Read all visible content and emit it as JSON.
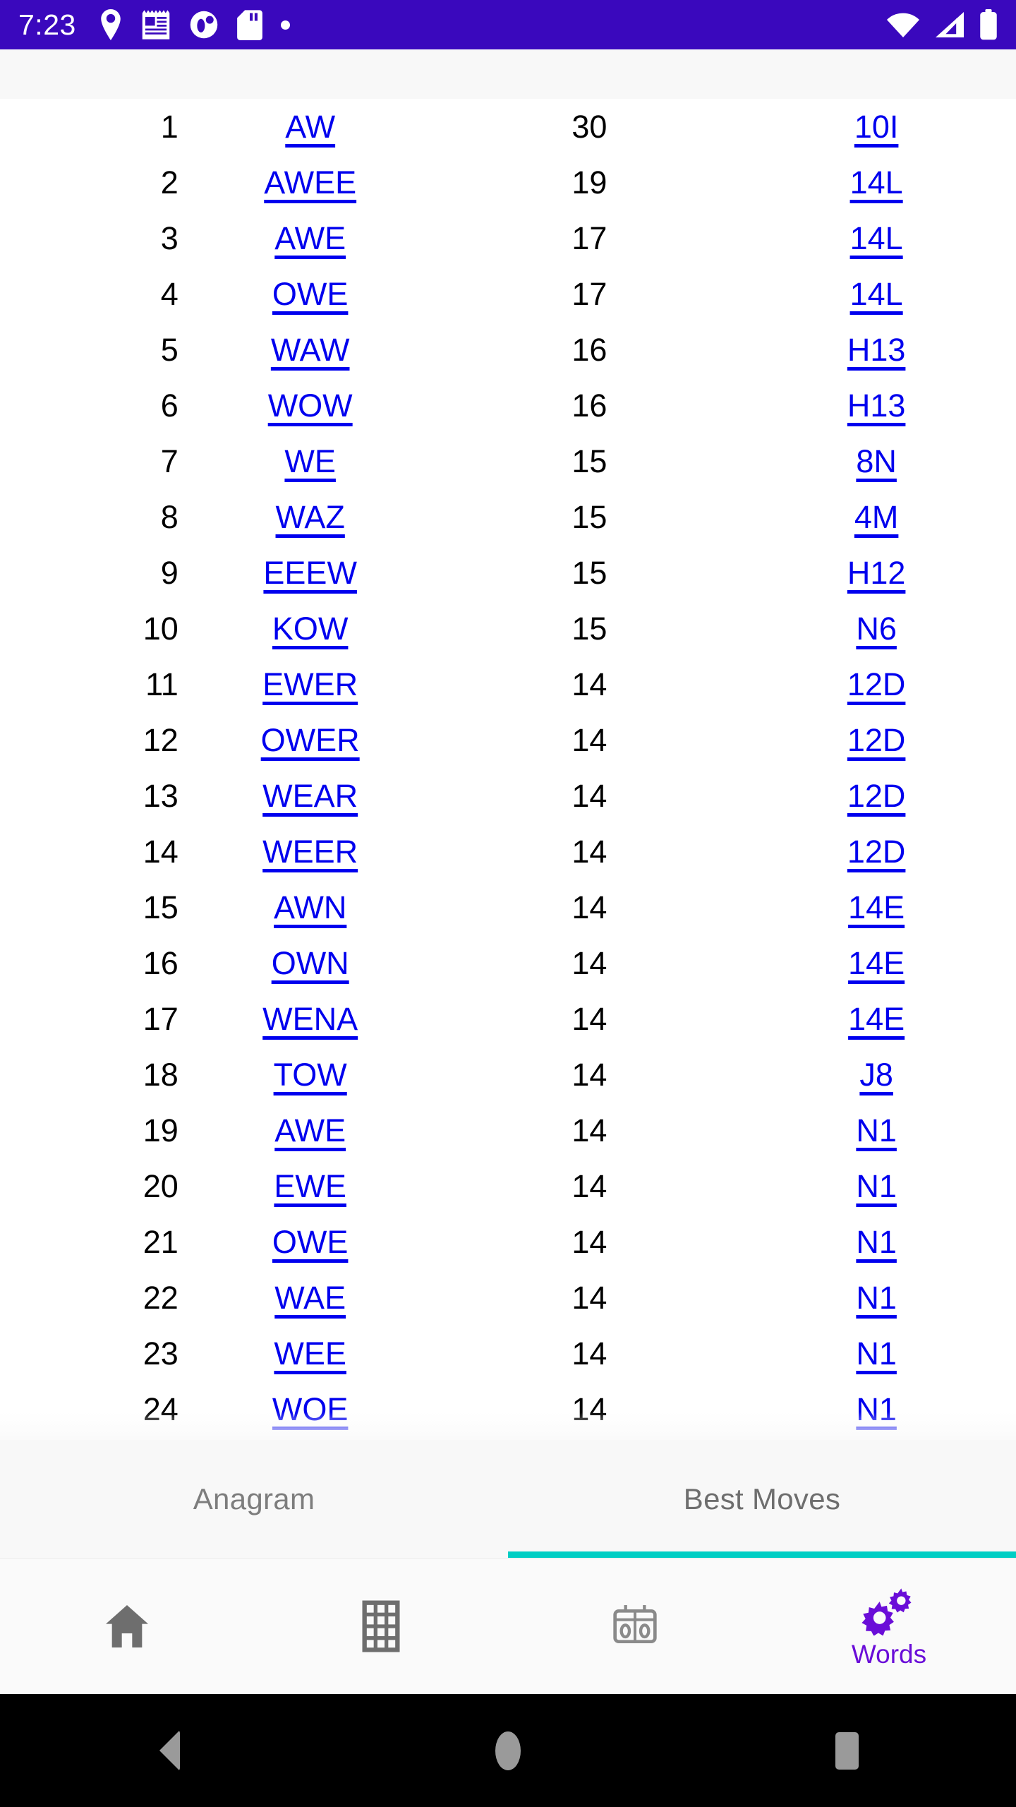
{
  "status_bar": {
    "time": "7:23",
    "background_color": "#3A08BD",
    "left_icons": [
      "location-pin-icon",
      "notepad-icon",
      "circle-glyph-icon",
      "sd-card-icon",
      "dot-icon"
    ],
    "right_icons": [
      "wifi-icon",
      "cellular-signal-icon",
      "battery-icon"
    ]
  },
  "table": {
    "link_color": "#0000EE",
    "text_color": "#000000",
    "rows": [
      {
        "rank": "1",
        "word": "AW",
        "score": "30",
        "position": "10I"
      },
      {
        "rank": "2",
        "word": "AWEE",
        "score": "19",
        "position": "14L"
      },
      {
        "rank": "3",
        "word": "AWE",
        "score": "17",
        "position": "14L"
      },
      {
        "rank": "4",
        "word": "OWE",
        "score": "17",
        "position": "14L"
      },
      {
        "rank": "5",
        "word": "WAW",
        "score": "16",
        "position": "H13"
      },
      {
        "rank": "6",
        "word": "WOW",
        "score": "16",
        "position": "H13"
      },
      {
        "rank": "7",
        "word": "WE",
        "score": "15",
        "position": "8N"
      },
      {
        "rank": "8",
        "word": "WAZ",
        "score": "15",
        "position": "4M"
      },
      {
        "rank": "9",
        "word": "EEEW",
        "score": "15",
        "position": "H12"
      },
      {
        "rank": "10",
        "word": "KOW",
        "score": "15",
        "position": "N6"
      },
      {
        "rank": "11",
        "word": "EWER",
        "score": "14",
        "position": "12D"
      },
      {
        "rank": "12",
        "word": "OWER",
        "score": "14",
        "position": "12D"
      },
      {
        "rank": "13",
        "word": "WEAR",
        "score": "14",
        "position": "12D"
      },
      {
        "rank": "14",
        "word": "WEER",
        "score": "14",
        "position": "12D"
      },
      {
        "rank": "15",
        "word": "AWN",
        "score": "14",
        "position": "14E"
      },
      {
        "rank": "16",
        "word": "OWN",
        "score": "14",
        "position": "14E"
      },
      {
        "rank": "17",
        "word": "WENA",
        "score": "14",
        "position": "14E"
      },
      {
        "rank": "18",
        "word": "TOW",
        "score": "14",
        "position": "J8"
      },
      {
        "rank": "19",
        "word": "AWE",
        "score": "14",
        "position": "N1"
      },
      {
        "rank": "20",
        "word": "EWE",
        "score": "14",
        "position": "N1"
      },
      {
        "rank": "21",
        "word": "OWE",
        "score": "14",
        "position": "N1"
      },
      {
        "rank": "22",
        "word": "WAE",
        "score": "14",
        "position": "N1"
      },
      {
        "rank": "23",
        "word": "WEE",
        "score": "14",
        "position": "N1"
      },
      {
        "rank": "24",
        "word": "WOE",
        "score": "14",
        "position": "N1"
      }
    ]
  },
  "tabs": {
    "indicator_color": "#00CEC4",
    "items": [
      {
        "label": "Anagram",
        "active": false
      },
      {
        "label": "Best Moves",
        "active": true
      }
    ]
  },
  "bottom_nav": {
    "active_color": "#6A0DD8",
    "inactive_color": "#757575",
    "items": [
      {
        "icon": "home-icon",
        "label": "",
        "active": false
      },
      {
        "icon": "grid-icon",
        "label": "",
        "active": false
      },
      {
        "icon": "scoreboard-icon",
        "label": "",
        "active": false
      },
      {
        "icon": "gears-icon",
        "label": "Words",
        "active": true
      }
    ]
  },
  "android_nav": {
    "buttons": [
      "back-button",
      "home-button",
      "recents-button"
    ]
  }
}
